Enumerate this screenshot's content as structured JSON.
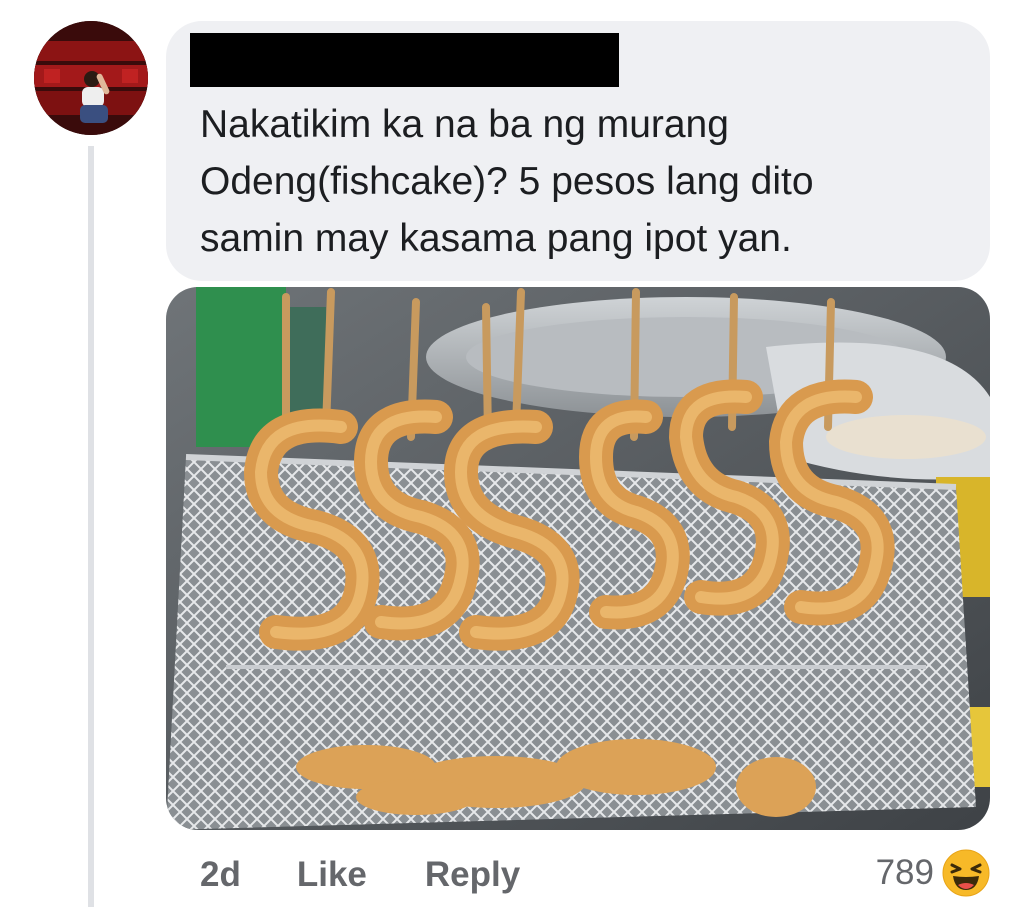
{
  "comment": {
    "text": "Nakatikim ka na ba ng murang\nOdeng(fishcake)?  5 pesos lang dito\nsamin may kasama pang ipot yan."
  },
  "actions": {
    "time": "2d",
    "like": "Like",
    "reply": "Reply"
  },
  "reactions": {
    "count": "789",
    "icon": "haha-emoji-icon"
  },
  "colors": {
    "bubble": "#eff0f3",
    "text": "#1c1e21",
    "meta": "#65676b",
    "haha": "#f7b928"
  }
}
